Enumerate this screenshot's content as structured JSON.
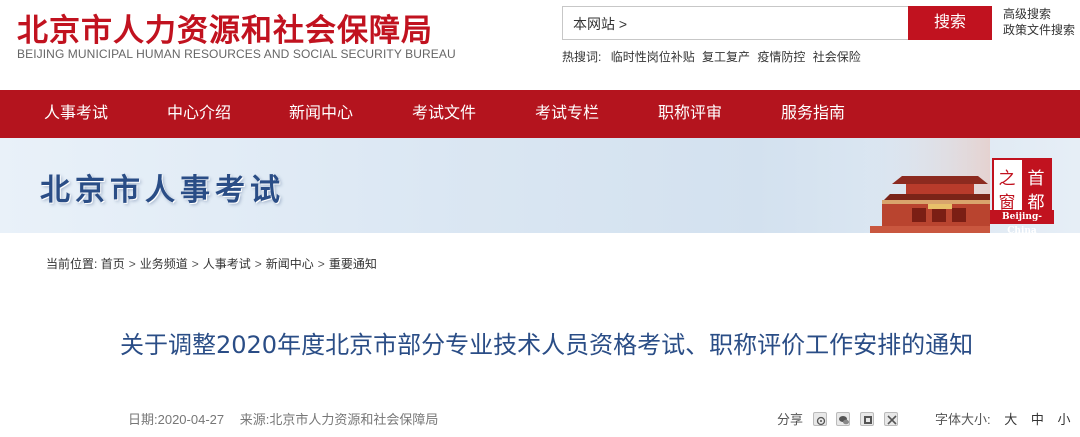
{
  "header": {
    "logo_cn": "北京市人力资源和社会保障局",
    "logo_en": "BEIJING MUNICIPAL HUMAN RESOURCES AND SOCIAL SECURITY BUREAU",
    "search_scope": "本网站 >",
    "search_button": "搜索",
    "advanced_search": "高级搜索",
    "policy_search": "政策文件搜索",
    "hot_label": "热搜词:",
    "hot_words": [
      "临时性岗位补贴",
      "复工复产",
      "疫情防控",
      "社会保险"
    ]
  },
  "nav": {
    "items": [
      "人事考试",
      "中心介绍",
      "新闻中心",
      "考试文件",
      "考试专栏",
      "职称评审",
      "服务指南"
    ]
  },
  "banner": {
    "title": "北京市人事考试",
    "seal_chars": [
      "之",
      "首",
      "窗",
      "都"
    ],
    "seal_caption": "Beijing-China"
  },
  "breadcrumb": {
    "label": "当前位置:",
    "items": [
      "首页",
      "业务频道",
      "人事考试",
      "新闻中心",
      "重要通知"
    ],
    "separator": ">"
  },
  "article": {
    "title": "关于调整2020年度北京市部分专业技术人员资格考试、职称评价工作安排的通知",
    "date": "日期:2020-04-27",
    "source": "来源:北京市人力资源和社会保障局"
  },
  "tools": {
    "share_label": "分享",
    "font_size_label": "字体大小:",
    "font_sizes": [
      "大",
      "中",
      "小"
    ]
  },
  "colors": {
    "brand_red": "#c1121f",
    "nav_red": "#b4141e",
    "title_blue": "#2a4d86"
  }
}
